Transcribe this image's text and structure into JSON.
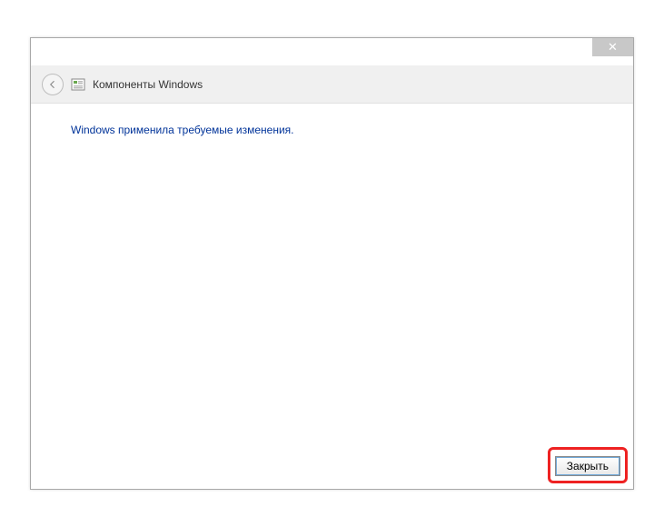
{
  "titlebar": {
    "close_symbol": "✕"
  },
  "header": {
    "title": "Компоненты Windows"
  },
  "content": {
    "message": "Windows применила требуемые изменения."
  },
  "footer": {
    "close_label": "Закрыть"
  }
}
